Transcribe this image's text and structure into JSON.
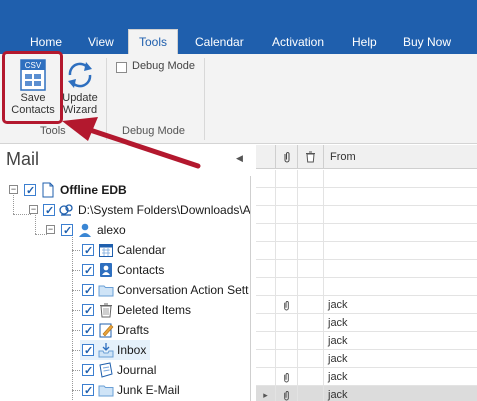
{
  "ribbon_tabs": [
    "Home",
    "View",
    "Tools",
    "Calendar",
    "Activation",
    "Help",
    "Buy Now"
  ],
  "active_tab": "Tools",
  "tools_group": {
    "save_contacts": {
      "line1": "Save",
      "line2": "Contacts",
      "icon_text": "CSV"
    },
    "update_wizard": {
      "line1": "Update",
      "line2": "Wizard"
    },
    "label": "Tools"
  },
  "debug_group": {
    "checkbox_label": "Debug Mode",
    "checked": false,
    "label": "Debug Mode"
  },
  "left_pane": {
    "title": "Mail",
    "tree": [
      {
        "label": "Offline EDB",
        "bold": true,
        "icon": "file-icon"
      },
      {
        "label": "D:\\System Folders\\Downloads\\A",
        "icon": "database-icon"
      },
      {
        "label": "alexo",
        "icon": "user-icon"
      },
      {
        "label": "Calendar",
        "icon": "calendar-icon"
      },
      {
        "label": "Contacts",
        "icon": "contacts-icon"
      },
      {
        "label": "Conversation Action Sett",
        "icon": "folder-icon"
      },
      {
        "label": "Deleted Items",
        "icon": "trash-icon"
      },
      {
        "label": "Drafts",
        "icon": "drafts-icon"
      },
      {
        "label": "Inbox",
        "icon": "inbox-icon",
        "selected": true
      },
      {
        "label": "Journal",
        "icon": "journal-icon"
      },
      {
        "label": "Junk E-Mail",
        "icon": "folder-icon"
      }
    ]
  },
  "grid": {
    "col_attach": "attachment-icon",
    "col_delete": "trash-icon",
    "col_from": "From",
    "rows": [
      {
        "attach": false,
        "from": ""
      },
      {
        "attach": false,
        "from": ""
      },
      {
        "attach": false,
        "from": ""
      },
      {
        "attach": false,
        "from": ""
      },
      {
        "attach": false,
        "from": ""
      },
      {
        "attach": false,
        "from": ""
      },
      {
        "attach": false,
        "from": ""
      },
      {
        "attach": true,
        "from": "jack"
      },
      {
        "attach": false,
        "from": "jack"
      },
      {
        "attach": false,
        "from": "jack"
      },
      {
        "attach": false,
        "from": "jack"
      },
      {
        "attach": true,
        "from": "jack"
      },
      {
        "attach": true,
        "from": "jack",
        "current": true
      }
    ]
  },
  "colors": {
    "ribbon_blue": "#1f5fad",
    "highlight_red": "#b3182e"
  }
}
